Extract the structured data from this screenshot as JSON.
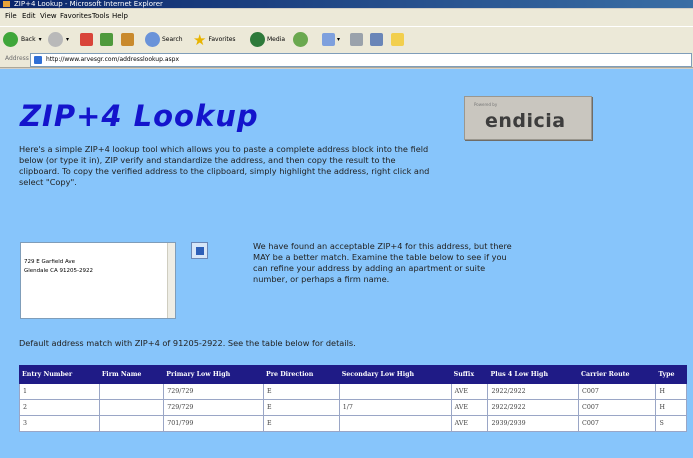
{
  "window": {
    "title": "ZIP+4 Lookup - Microsoft Internet Explorer"
  },
  "menu": [
    "File",
    "Edit",
    "View",
    "Favorites",
    "Tools",
    "Help"
  ],
  "toolbar": {
    "back": "Back",
    "search": "Search",
    "favorites": "Favorites",
    "media": "Media"
  },
  "address_bar": {
    "label": "Address",
    "url": "http://www.arvesgr.com/addresslookup.aspx"
  },
  "page": {
    "title": "ZIP+4 Lookup",
    "logo": {
      "small": "Powered by",
      "brand": "endicia"
    },
    "intro": "Here's a simple ZIP+4 lookup tool which allows you to paste a complete address block into the field below (or type it in), ZIP verify and standardize the address, and then copy the result to the clipboard. To copy the verified address to the clipboard, simply highlight the address, right click and select \"Copy\".",
    "address_lines": [
      "729 E Garfield Ave",
      "Glendale CA 91205-2922"
    ],
    "message": "We have found an acceptable ZIP+4 for this address, but there MAY be a better match. Examine the table below to see if you can refine your address by adding an apartment or suite number, or perhaps a firm name.",
    "default_match": "Default address match with ZIP+4 of 91205-2922. See the table below for details."
  },
  "table": {
    "headers": [
      "Entry Number",
      "Firm Name",
      "Primary Low High",
      "Pre Direction",
      "Secondary Low High",
      "Suffix",
      "Plus 4 Low High",
      "Carrier Route",
      "Type"
    ],
    "rows": [
      [
        "1",
        "",
        "729/729",
        "E",
        "",
        "AVE",
        "2922/2922",
        "C007",
        "H"
      ],
      [
        "2",
        "",
        "729/729",
        "E",
        "1/7",
        "AVE",
        "2922/2922",
        "C007",
        "H"
      ],
      [
        "3",
        "",
        "701/799",
        "E",
        "",
        "AVE",
        "2939/2939",
        "C007",
        "S"
      ]
    ]
  },
  "colors": {
    "page_background": "#87c5fb",
    "title": "#1414cc",
    "table_header": "#1f1b86"
  }
}
